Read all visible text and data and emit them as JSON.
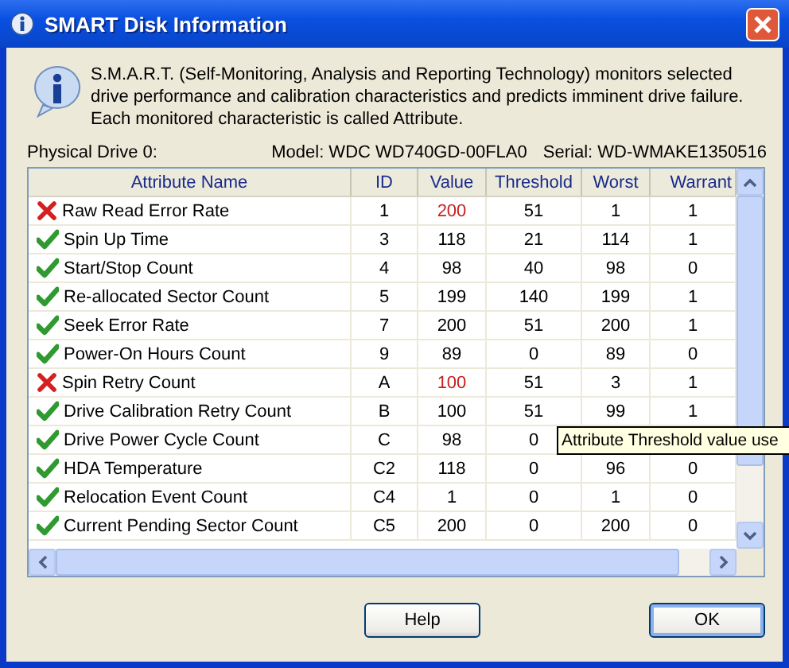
{
  "window": {
    "title": "SMART Disk Information"
  },
  "description": "S.M.A.R.T. (Self-Monitoring, Analysis and Reporting Technology) monitors selected drive performance and calibration characteristics and predicts imminent drive failure. Each monitored characteristic is called Attribute.",
  "drive": {
    "label": "Physical Drive 0:",
    "model": "Model: WDC WD740GD-00FLA0",
    "serial": "Serial: WD-WMAKE1350516"
  },
  "table": {
    "columns": [
      "Attribute Name",
      "ID",
      "Value",
      "Threshold",
      "Worst",
      "Warrant"
    ],
    "rows": [
      {
        "failed": true,
        "name": "Raw Read Error Rate",
        "id": "1",
        "value": "200",
        "threshold": "51",
        "worst": "1",
        "warranty": "1"
      },
      {
        "failed": false,
        "name": "Spin Up Time",
        "id": "3",
        "value": "118",
        "threshold": "21",
        "worst": "114",
        "warranty": "1"
      },
      {
        "failed": false,
        "name": "Start/Stop Count",
        "id": "4",
        "value": "98",
        "threshold": "40",
        "worst": "98",
        "warranty": "0"
      },
      {
        "failed": false,
        "name": "Re-allocated Sector Count",
        "id": "5",
        "value": "199",
        "threshold": "140",
        "worst": "199",
        "warranty": "1"
      },
      {
        "failed": false,
        "name": "Seek Error Rate",
        "id": "7",
        "value": "200",
        "threshold": "51",
        "worst": "200",
        "warranty": "1"
      },
      {
        "failed": false,
        "name": "Power-On Hours Count",
        "id": "9",
        "value": "89",
        "threshold": "0",
        "worst": "89",
        "warranty": "0"
      },
      {
        "failed": true,
        "name": "Spin Retry Count",
        "id": "A",
        "value": "100",
        "threshold": "51",
        "worst": "3",
        "warranty": "1"
      },
      {
        "failed": false,
        "name": "Drive Calibration Retry Count",
        "id": "B",
        "value": "100",
        "threshold": "51",
        "worst": "99",
        "warranty": "1"
      },
      {
        "failed": false,
        "name": "Drive Power Cycle Count",
        "id": "C",
        "value": "98",
        "threshold": "0"
      },
      {
        "failed": false,
        "name": "HDA Temperature",
        "id": "C2",
        "value": "118",
        "threshold": "0",
        "worst": "96",
        "warranty": "0"
      },
      {
        "failed": false,
        "name": "Relocation Event Count",
        "id": "C4",
        "value": "1",
        "threshold": "0",
        "worst": "1",
        "warranty": "0"
      },
      {
        "failed": false,
        "name": "Current Pending Sector Count",
        "id": "C5",
        "value": "200",
        "threshold": "0",
        "worst": "200",
        "warranty": "0"
      }
    ]
  },
  "tooltip": "Attribute Threshold value use",
  "buttons": [
    {
      "label": "Help",
      "default": false
    },
    {
      "label": "OK",
      "default": true
    }
  ]
}
